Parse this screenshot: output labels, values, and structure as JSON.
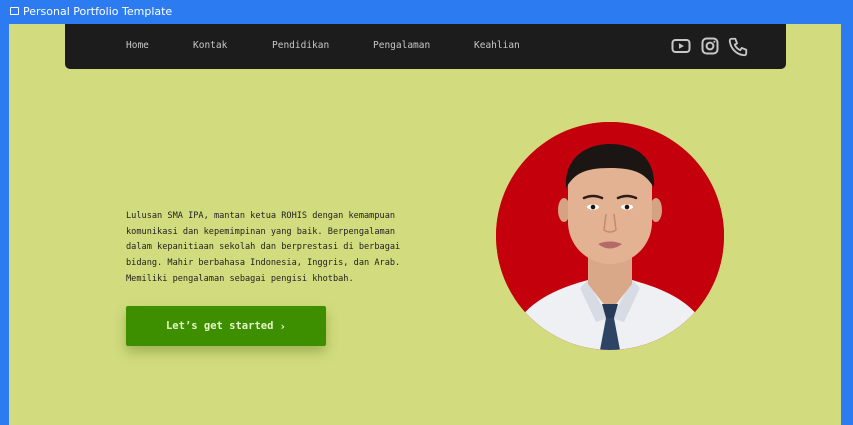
{
  "window": {
    "title": "Personal Portfolio Template"
  },
  "nav": {
    "links": [
      {
        "label": "Home"
      },
      {
        "label": "Kontak"
      },
      {
        "label": "Pendidikan"
      },
      {
        "label": "Pengalaman"
      },
      {
        "label": "Keahlian"
      }
    ],
    "icons": [
      "youtube-icon",
      "instagram-icon",
      "phone-icon"
    ]
  },
  "hero": {
    "bio_lines": [
      "Lulusan SMA IPA, mantan ketua ROHIS dengan kemampuan",
      "komunikasi dan kepemimpinan yang baik. Berpengalaman",
      "dalam kepanitiaan sekolah dan berprestasi di berbagai",
      "bidang. Mahir berbahasa Indonesia, Inggris, dan Arab.",
      "Memiliki pengalaman sebagai pengisi khotbah."
    ],
    "cta_label": "Let’s get started",
    "cta_icon": "chevron-right-icon"
  },
  "colors": {
    "page_background": "#d2dc7e",
    "navbar": "#1c1c1c",
    "cta": "#3d8f00",
    "portrait_background": "#c4000c",
    "frame": "#2d7bf0"
  }
}
